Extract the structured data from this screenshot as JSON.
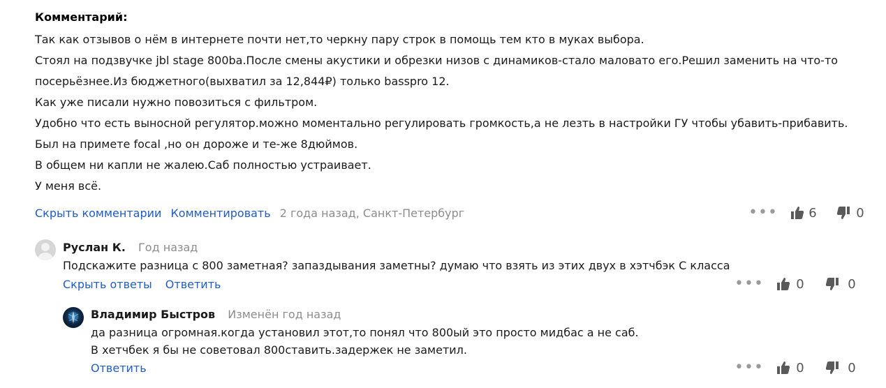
{
  "review": {
    "heading": "Комментарий:",
    "lines": [
      "Так как отзывов о нём в интернете почти нет,то черкну пару строк в помощь тем кто в муках выбора.",
      "Стоял на подзвучке jbl stage 800ba.После смены акустики и обрезки низов с динамиков-стало маловато его.Решил заменить на что-то",
      "посерьёзнее.Из бюджетного(выхватил за 12,844₽) только basspro 12.",
      "Как уже писали нужно повозиться с фильтром.",
      "Удобно что есть выносной регулятор.можно моментально регулировать громкость,а не лезть в настройки ГУ чтобы убавить-прибавить.",
      "Был на примете focal ,но он дороже и те-же 8дюймов.",
      "В общем ни капли не жалею.Саб полностью устраивает.",
      "У меня всё."
    ],
    "actions": {
      "hide_comments": "Скрыть комментарии",
      "comment": "Комментировать",
      "meta": "2 года назад, Санкт-Петербург"
    },
    "likes": "6",
    "dislikes": "0"
  },
  "comments": [
    {
      "author": "Руслан К.",
      "time": "Год назад",
      "lines": [
        "Подскажите разница с 800 заметная? запаздывания заметны? думаю что взять из этих двух в хэтчбэк С класса"
      ],
      "hide_replies": "Скрыть ответы",
      "reply": "Ответить",
      "likes": "0",
      "dislikes": "0"
    },
    {
      "author": "Владимир Быстров",
      "time": "Изменён год назад",
      "lines": [
        "да разница огромная.когда установил этот,то понял что 800ый это просто мидбас а не саб.",
        "В хетчбек я бы не советовал 800ставить.задержек не заметил."
      ],
      "reply": "Ответить",
      "likes": "0",
      "dislikes": "0"
    }
  ],
  "icons": {
    "more": "more-dots-icon",
    "like": "thumb-up-icon",
    "dislike": "thumb-down-icon",
    "avatar_placeholder": "user-avatar-icon"
  },
  "colors": {
    "link": "#1f5cc7",
    "muted": "#8c8c8c",
    "text": "#1a1a1a",
    "icon": "#5a5a5a"
  }
}
